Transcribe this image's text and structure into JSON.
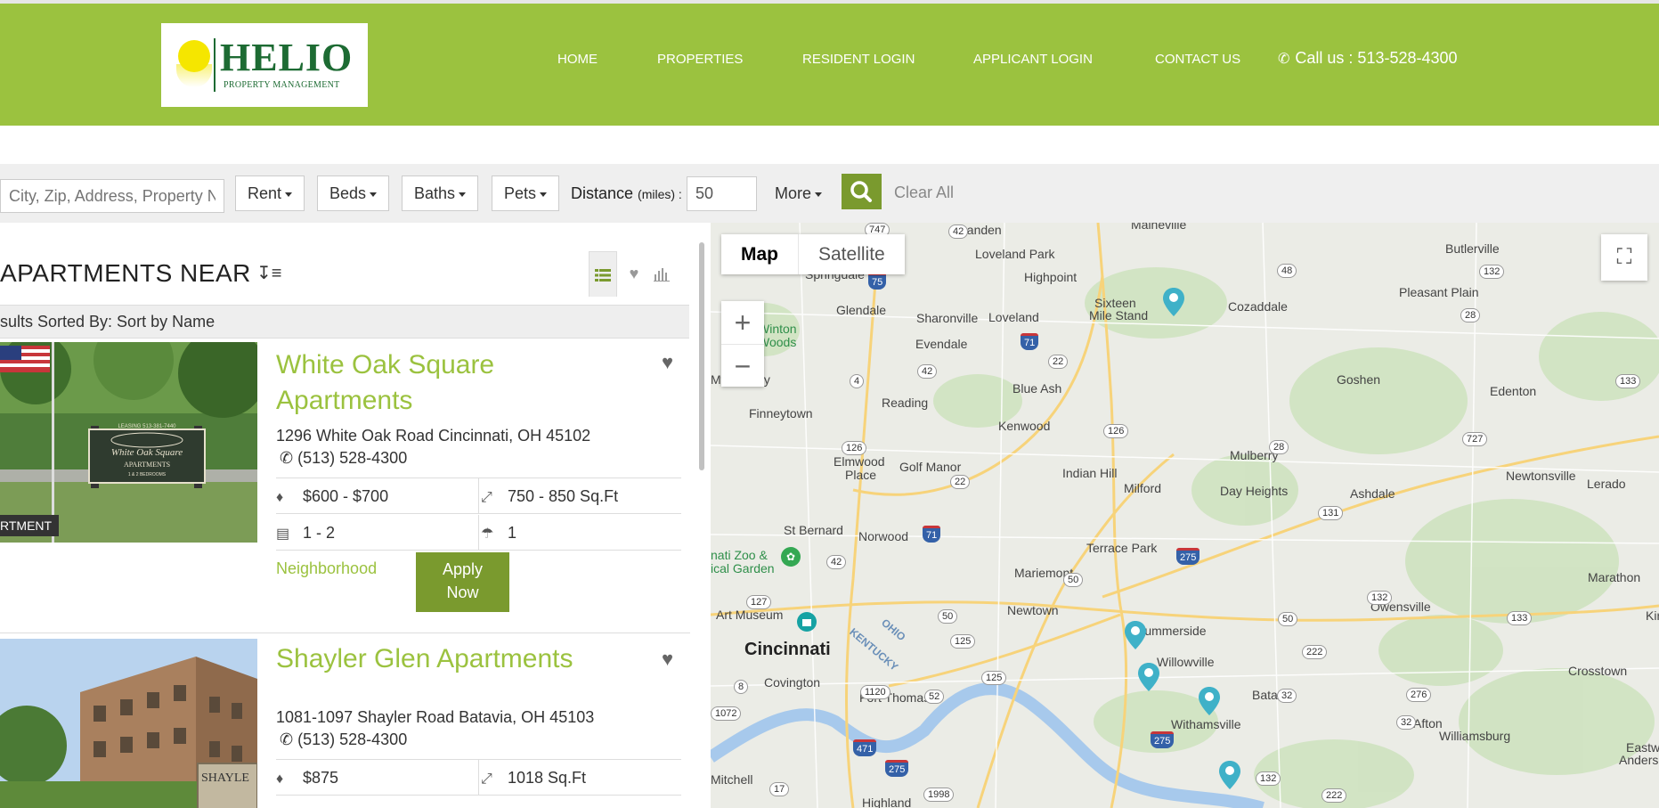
{
  "header": {
    "logo_word": "HELIO",
    "logo_subtitle": "PROPERTY MANAGEMENT",
    "nav": [
      {
        "label": "HOME"
      },
      {
        "label": "PROPERTIES"
      },
      {
        "label": "RESIDENT LOGIN"
      },
      {
        "label": "APPLICANT LOGIN"
      },
      {
        "label": "CONTACT US"
      }
    ],
    "call_label": "Call us : 513-528-4300"
  },
  "search": {
    "placeholder": "City, Zip, Address, Property N",
    "filters": [
      {
        "label": "Rent"
      },
      {
        "label": "Beds"
      },
      {
        "label": "Baths"
      },
      {
        "label": "Pets"
      }
    ],
    "distance_label": "Distance",
    "distance_unit": "(miles) :",
    "distance_value": "50",
    "more_label": "More",
    "clear_label": "Clear All"
  },
  "list": {
    "title": "APARTMENTS NEAR",
    "sort_text": "sults Sorted By: Sort by Name",
    "properties": [
      {
        "name_line1": "White Oak Square",
        "name_line2": "Apartments",
        "address": "1296 White Oak Road Cincinnati, OH 45102",
        "phone": "(513) 528-4300",
        "rent": "$600 - $700",
        "sqft": "750 - 850 Sq.Ft",
        "beds": "1 - 2",
        "baths": "1",
        "neighborhood": "Neighborhood",
        "apply_line1": "Apply",
        "apply_line2": "Now",
        "badge": "RTMENT",
        "sign_leasing": "LEASING 513-381-7440",
        "sign_name": "White Oak Square",
        "sign_sub": "APARTMENTS",
        "sign_rooms": "1 & 2 BEDROOMS"
      },
      {
        "name": "Shayler Glen Apartments",
        "address": "1081-1097 Shayler Road Batavia, OH 45103",
        "phone": "(513) 528-4300",
        "rent": "$875",
        "sqft": "1018 Sq.Ft",
        "sign_text": "SHAYLE"
      }
    ]
  },
  "map": {
    "tab_map": "Map",
    "tab_satellite": "Satellite",
    "labels": [
      {
        "text": "Landen"
      },
      {
        "text": "Maineville"
      },
      {
        "text": "Loveland Park"
      },
      {
        "text": "Butlerville"
      },
      {
        "text": "Springdale"
      },
      {
        "text": "Highpoint"
      },
      {
        "text": "Sixteen"
      },
      {
        "text": "Mile Stand"
      },
      {
        "text": "Loveland"
      },
      {
        "text": "Cozaddale"
      },
      {
        "text": "Pleasant Plain"
      },
      {
        "text": "Glendale"
      },
      {
        "text": "Sharonville"
      },
      {
        "text": "Winton"
      },
      {
        "text": "Woods"
      },
      {
        "text": "Evendale"
      },
      {
        "text": "Mt Healthy"
      },
      {
        "text": "Blue Ash"
      },
      {
        "text": "Goshen"
      },
      {
        "text": "Edenton"
      },
      {
        "text": "Reading"
      },
      {
        "text": "Finneytown"
      },
      {
        "text": "Kenwood"
      },
      {
        "text": "Mulberry"
      },
      {
        "text": "Elmwood"
      },
      {
        "text": "Place"
      },
      {
        "text": "Golf Manor"
      },
      {
        "text": "Indian Hill"
      },
      {
        "text": "Newtonsville"
      },
      {
        "text": "Milford"
      },
      {
        "text": "Day Heights"
      },
      {
        "text": "Ashdale"
      },
      {
        "text": "Lerado"
      },
      {
        "text": "St Bernard"
      },
      {
        "text": "Norwood"
      },
      {
        "text": "Terrace Park"
      },
      {
        "text": "nati Zoo &"
      },
      {
        "text": "ical Garden"
      },
      {
        "text": "Mariemont"
      },
      {
        "text": "Marathon"
      },
      {
        "text": "Newtown"
      },
      {
        "text": "Art Museum"
      },
      {
        "text": "Summerside"
      },
      {
        "text": "Owensville"
      },
      {
        "text": "Kirby"
      },
      {
        "text": "Cincinnati"
      },
      {
        "text": "Willowville"
      },
      {
        "text": "Crosstown"
      },
      {
        "text": "Covington"
      },
      {
        "text": "Batavia"
      },
      {
        "text": "Fort Thomas"
      },
      {
        "text": "Afton"
      },
      {
        "text": "Withamsville"
      },
      {
        "text": "Williamsburg"
      },
      {
        "text": "Eastwo"
      },
      {
        "text": "Anderson"
      },
      {
        "text": "Mitchell"
      },
      {
        "text": "Highland"
      },
      {
        "text": "OHIO"
      },
      {
        "text": "KENTUCKY"
      }
    ],
    "routes": [
      {
        "text": "747"
      },
      {
        "text": "42"
      },
      {
        "text": "75"
      },
      {
        "text": "48"
      },
      {
        "text": "132"
      },
      {
        "text": "28"
      },
      {
        "text": "71"
      },
      {
        "text": "22"
      },
      {
        "text": "42"
      },
      {
        "text": "4"
      },
      {
        "text": "133"
      },
      {
        "text": "126"
      },
      {
        "text": "727"
      },
      {
        "text": "28"
      },
      {
        "text": "126"
      },
      {
        "text": "22"
      },
      {
        "text": "131"
      },
      {
        "text": "71"
      },
      {
        "text": "275"
      },
      {
        "text": "42"
      },
      {
        "text": "50"
      },
      {
        "text": "127"
      },
      {
        "text": "50"
      },
      {
        "text": "132"
      },
      {
        "text": "125"
      },
      {
        "text": "50"
      },
      {
        "text": "133"
      },
      {
        "text": "222"
      },
      {
        "text": "125"
      },
      {
        "text": "8"
      },
      {
        "text": "1120"
      },
      {
        "text": "52"
      },
      {
        "text": "32"
      },
      {
        "text": "276"
      },
      {
        "text": "1072"
      },
      {
        "text": "471"
      },
      {
        "text": "275"
      },
      {
        "text": "32"
      },
      {
        "text": "275"
      },
      {
        "text": "17"
      },
      {
        "text": "1998"
      },
      {
        "text": "132"
      },
      {
        "text": "222"
      }
    ]
  }
}
